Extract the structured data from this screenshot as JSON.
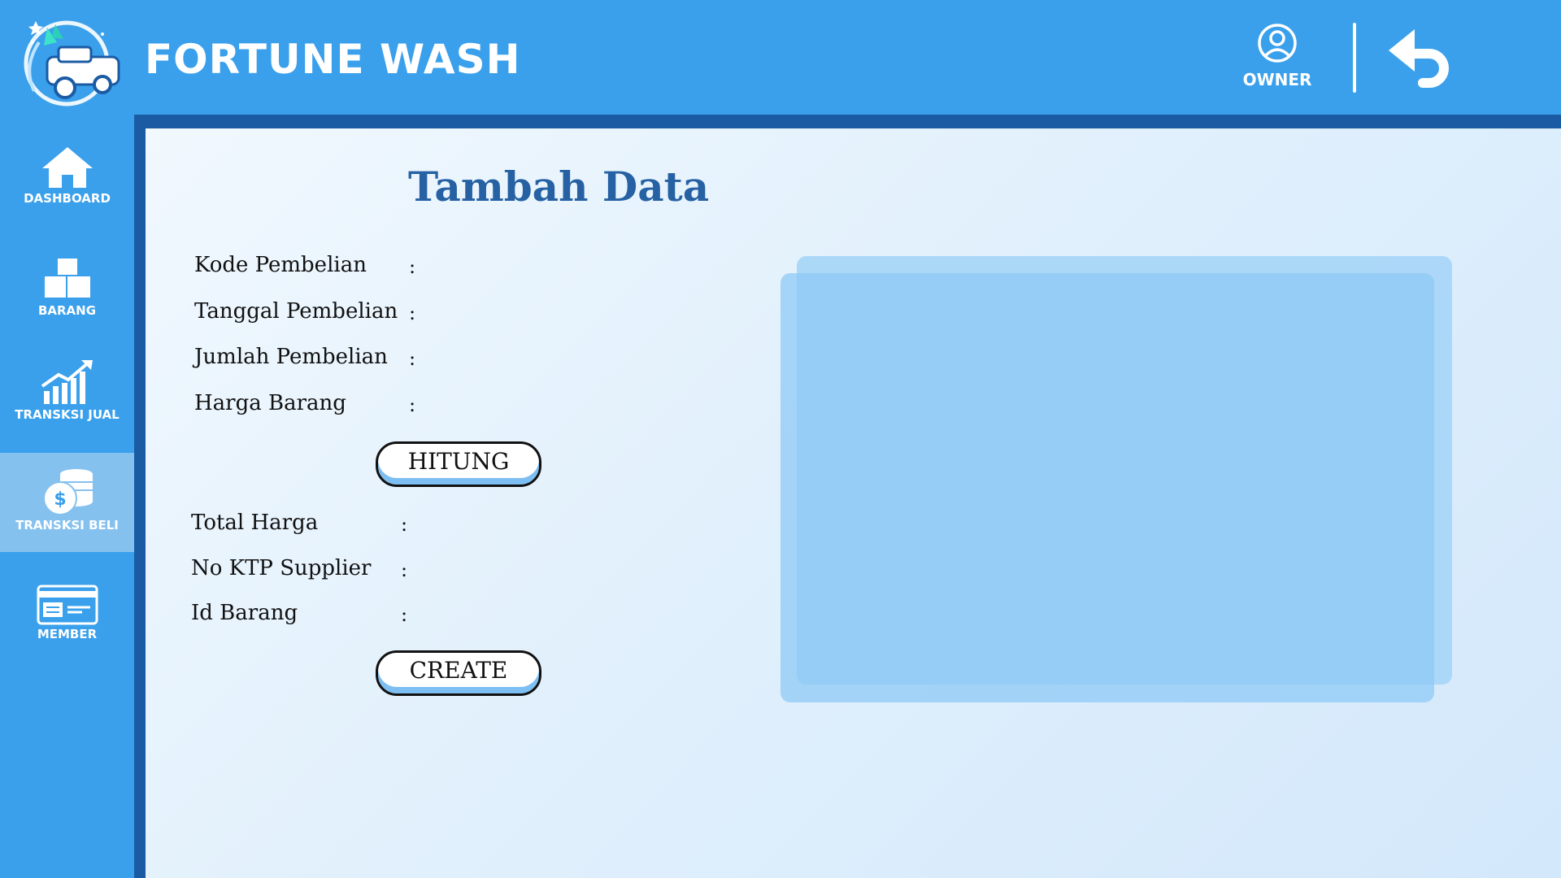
{
  "app": {
    "title": "FORTUNE WASH",
    "logo_icon": "car-wash-logo"
  },
  "header": {
    "user_label": "OWNER",
    "user_icon": "user-circle-icon",
    "back_icon": "back-arrow-icon"
  },
  "sidebar": {
    "items": [
      {
        "label": "DASHBOARD",
        "icon": "home-icon",
        "active": false
      },
      {
        "label": "BARANG",
        "icon": "boxes-icon",
        "active": false
      },
      {
        "label": "TRANSKSI JUAL",
        "icon": "chart-up-icon",
        "active": false
      },
      {
        "label": "TRANSKSI BELI",
        "icon": "coins-icon",
        "active": true
      },
      {
        "label": "MEMBER",
        "icon": "member-card-icon",
        "active": false
      }
    ]
  },
  "form": {
    "title": "Tambah Data",
    "fields_top": [
      {
        "label": "Kode Pembelian",
        "separator": ":",
        "value": ""
      },
      {
        "label": "Tanggal Pembelian",
        "separator": ":",
        "value": ""
      },
      {
        "label": "Jumlah Pembelian",
        "separator": ":",
        "value": ""
      },
      {
        "label": "Harga Barang",
        "separator": ":",
        "value": ""
      }
    ],
    "calculate_button": "HITUNG",
    "fields_bottom": [
      {
        "label": "Total Harga",
        "separator": ":",
        "value": ""
      },
      {
        "label": "No KTP Supplier",
        "separator": ":",
        "value": ""
      },
      {
        "label": "Id Barang",
        "separator": ":",
        "value": ""
      }
    ],
    "create_button": "CREATE"
  },
  "colors": {
    "primary": "#3aa0ec",
    "dark_frame": "#1b5ba4",
    "title_text": "#2561a3",
    "active_nav": "#85c1ef",
    "button_shadow": "#7dbff2"
  }
}
